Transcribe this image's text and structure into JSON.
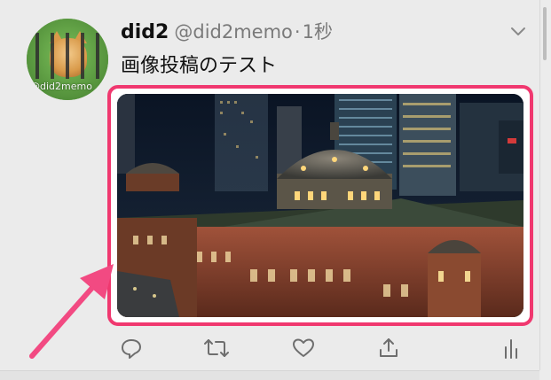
{
  "tweet": {
    "display_name": "did2",
    "username": "@did2memo",
    "separator": "·",
    "time": "1秒",
    "text": "画像投稿のテスト",
    "avatar_text": "@did2memo",
    "media": {
      "subject": "Tokyo Station at night photo"
    }
  },
  "actions": [
    {
      "icon": "reply-icon"
    },
    {
      "icon": "retweet-icon"
    },
    {
      "icon": "like-icon"
    },
    {
      "icon": "share-icon"
    },
    {
      "icon": "analytics-icon"
    }
  ],
  "colors": {
    "highlight": "#f0386f",
    "arrow": "#f24a82",
    "icon": "#6e6e6e"
  }
}
